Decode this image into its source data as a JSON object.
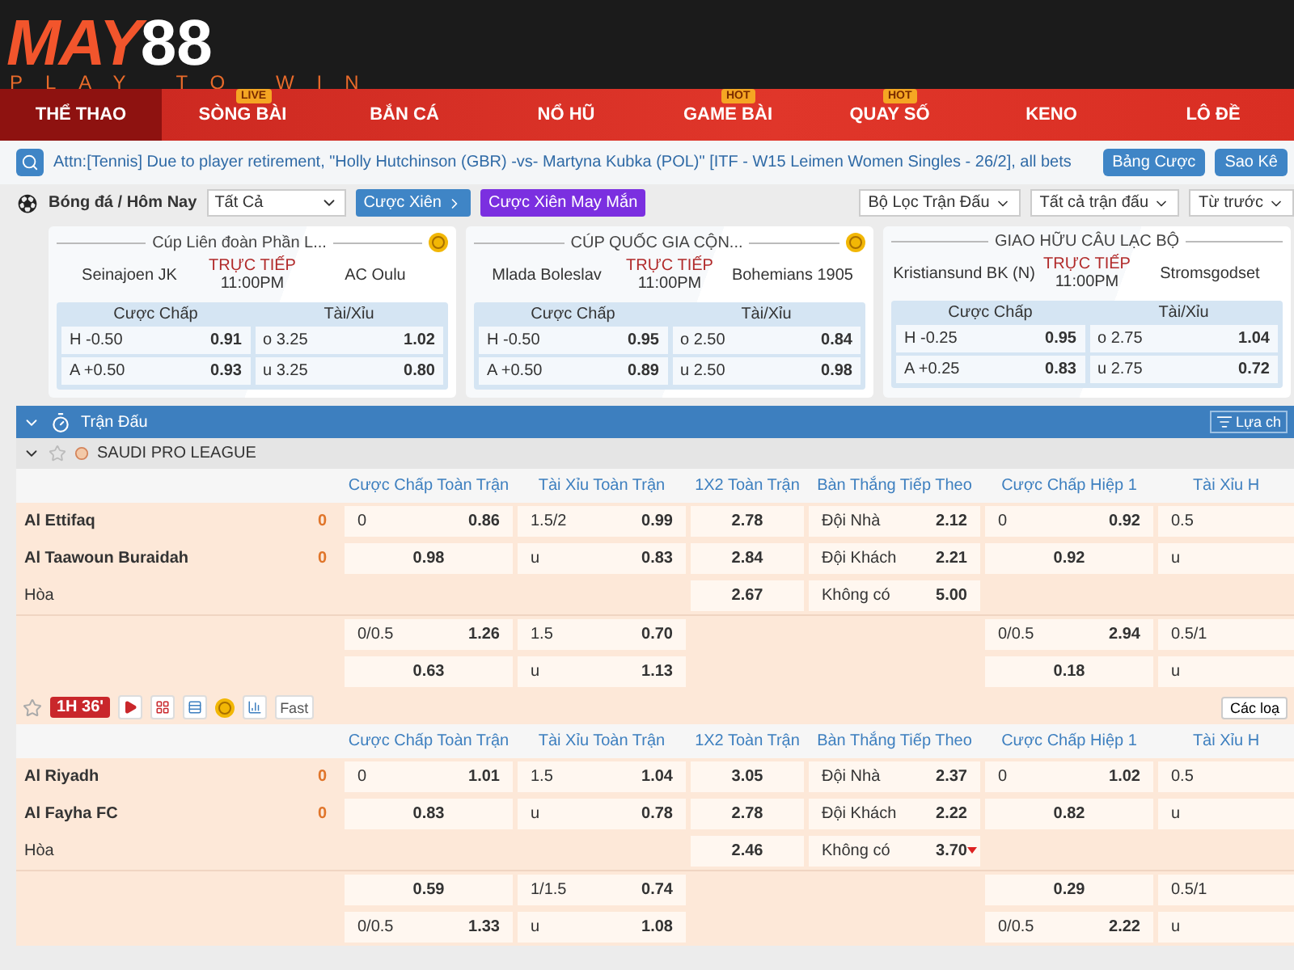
{
  "logo": {
    "brand_a": "MAY",
    "brand_b": "88",
    "tagline": "PLAY TO WIN"
  },
  "nav": [
    {
      "label": "THỂ THAO",
      "selected": true
    },
    {
      "label": "SÒNG BÀI",
      "selected": false,
      "badge": "LIVE"
    },
    {
      "label": "BẮN CÁ",
      "selected": false
    },
    {
      "label": "NỔ HŨ",
      "selected": false
    },
    {
      "label": "GAME BÀI",
      "selected": false,
      "badge": "HOT"
    },
    {
      "label": "QUAY SỐ",
      "selected": false,
      "badge": "HOT"
    },
    {
      "label": "KENO",
      "selected": false
    },
    {
      "label": "LÔ ĐỀ",
      "selected": false
    }
  ],
  "notice": {
    "text": "Attn:[Tennis] Due to player retirement, \"Holly Hutchinson (GBR) -vs- Martyna Kubka (POL)\" [ITF - W15 Leimen Women Singles - 26/2], all bets",
    "buttons": [
      "Bảng Cược",
      "Sao Kê"
    ]
  },
  "filter_bar": {
    "title": "Bóng đá / Hôm Nay",
    "select": "Tất Cả",
    "parlay": "Cược Xiên",
    "lucky_parlay": "Cược Xiên May Mắn",
    "dropdowns": [
      "Bộ Lọc Trận Đấu",
      "Tất cả trận đấu",
      "Từ trước"
    ]
  },
  "cards": [
    {
      "league": "Cúp Liên đoàn Phần L...",
      "coin": true,
      "home": "Seinajoen JK",
      "away": "AC Oulu",
      "status": "TRỰC TIẾP",
      "time": "11:00PM",
      "handicap_title": "Cược Chấp",
      "ou_title": "Tài/Xỉu",
      "handicap": [
        {
          "side": "H",
          "line": "-0.50",
          "odds": "0.91"
        },
        {
          "side": "A",
          "line": "+0.50",
          "odds": "0.93"
        }
      ],
      "ou": [
        {
          "side": "o",
          "line": "3.25",
          "odds": "1.02"
        },
        {
          "side": "u",
          "line": "3.25",
          "odds": "0.80"
        }
      ]
    },
    {
      "league": "CÚP QUỐC GIA CỘN...",
      "coin": true,
      "home": "Mlada Boleslav",
      "away": "Bohemians 1905",
      "status": "TRỰC TIẾP",
      "time": "11:00PM",
      "handicap_title": "Cược Chấp",
      "ou_title": "Tài/Xỉu",
      "handicap": [
        {
          "side": "H",
          "line": "-0.50",
          "odds": "0.95"
        },
        {
          "side": "A",
          "line": "+0.50",
          "odds": "0.89"
        }
      ],
      "ou": [
        {
          "side": "o",
          "line": "2.50",
          "odds": "0.84"
        },
        {
          "side": "u",
          "line": "2.50",
          "odds": "0.98"
        }
      ]
    },
    {
      "league": "GIAO HỮU CÂU LẠC BỘ",
      "coin": false,
      "home": "Kristiansund BK (N)",
      "away": "Stromsgodset",
      "status": "TRỰC TIẾP",
      "time": "11:00PM",
      "handicap_title": "Cược Chấp",
      "ou_title": "Tài/Xỉu",
      "handicap": [
        {
          "side": "H",
          "line": "-0.25",
          "odds": "0.95"
        },
        {
          "side": "A",
          "line": "+0.25",
          "odds": "0.83"
        }
      ],
      "ou": [
        {
          "side": "o",
          "line": "2.75",
          "odds": "1.04"
        },
        {
          "side": "u",
          "line": "2.75",
          "odds": "0.72"
        }
      ]
    }
  ],
  "section": {
    "title": "Trận Đấu",
    "button": "Lựa ch"
  },
  "league": {
    "name": "SAUDI PRO LEAGUE"
  },
  "matches": [
    {
      "columns": [
        "Cược Chấp Toàn Trận",
        "Tài Xỉu Toàn Trận",
        "1X2 Toàn Trận",
        "Bàn Thắng Tiếp Theo",
        "Cược Chấp Hiệp 1",
        "Tài Xỉu H"
      ],
      "rows": [
        {
          "team": "Al Ettifaq",
          "score": "0",
          "cells": [
            {
              "line": "0",
              "odds": "0.86"
            },
            {
              "line": "1.5/2",
              "odds": "0.99"
            },
            {
              "odds": "2.78"
            },
            {
              "line": "Đội Nhà",
              "odds": "2.12"
            },
            {
              "line": "0",
              "odds": "0.92"
            },
            {
              "line": "0.5"
            }
          ]
        },
        {
          "team": "Al Taawoun Buraidah",
          "score": "0",
          "cells": [
            {
              "odds": "0.98"
            },
            {
              "line": "u",
              "odds": "0.83"
            },
            {
              "odds": "2.84"
            },
            {
              "line": "Đội Khách",
              "odds": "2.21"
            },
            {
              "odds": "0.92"
            },
            {
              "line": "u"
            }
          ]
        },
        {
          "draw": "Hòa",
          "cells": [
            null,
            null,
            {
              "odds": "2.67"
            },
            {
              "line": "Không có",
              "odds": "5.00"
            },
            null,
            null
          ]
        }
      ],
      "extra_rows": [
        {
          "cells": [
            {
              "line": "0/0.5",
              "odds": "1.26"
            },
            {
              "line": "1.5",
              "odds": "0.70"
            },
            null,
            null,
            {
              "line": "0/0.5",
              "odds": "2.94"
            },
            {
              "line": "0.5/1"
            }
          ]
        },
        {
          "cells": [
            {
              "odds": "0.63"
            },
            {
              "line": "u",
              "odds": "1.13"
            },
            null,
            null,
            {
              "odds": "0.18"
            },
            {
              "line": "u"
            }
          ]
        }
      ]
    },
    {
      "toolbar": {
        "clock": "1H 36'",
        "fast": "Fast",
        "more": "Các loạ"
      },
      "columns": [
        "Cược Chấp Toàn Trận",
        "Tài Xỉu Toàn Trận",
        "1X2 Toàn Trận",
        "Bàn Thắng Tiếp Theo",
        "Cược Chấp Hiệp 1",
        "Tài Xỉu H"
      ],
      "rows": [
        {
          "team": "Al Riyadh",
          "score": "0",
          "cells": [
            {
              "line": "0",
              "odds": "1.01"
            },
            {
              "line": "1.5",
              "odds": "1.04"
            },
            {
              "odds": "3.05"
            },
            {
              "line": "Đội Nhà",
              "odds": "2.37"
            },
            {
              "line": "0",
              "odds": "1.02"
            },
            {
              "line": "0.5"
            }
          ]
        },
        {
          "team": "Al Fayha FC",
          "score": "0",
          "cells": [
            {
              "odds": "0.83"
            },
            {
              "line": "u",
              "odds": "0.78"
            },
            {
              "odds": "2.78"
            },
            {
              "line": "Đội Khách",
              "odds": "2.22"
            },
            {
              "odds": "0.82"
            },
            {
              "line": "u"
            }
          ]
        },
        {
          "draw": "Hòa",
          "cells": [
            null,
            null,
            {
              "odds": "2.46"
            },
            {
              "line": "Không có",
              "odds": "3.70",
              "falling": true
            },
            null,
            null
          ]
        }
      ],
      "extra_rows": [
        {
          "cells": [
            {
              "odds": "0.59"
            },
            {
              "line": "1/1.5",
              "odds": "0.74"
            },
            null,
            null,
            {
              "odds": "0.29"
            },
            {
              "line": "0.5/1"
            }
          ]
        },
        {
          "cells": [
            {
              "line": "0/0.5",
              "odds": "1.33"
            },
            {
              "line": "u",
              "odds": "1.08"
            },
            null,
            null,
            {
              "line": "0/0.5",
              "odds": "2.22"
            },
            {
              "line": "u"
            }
          ]
        }
      ]
    }
  ]
}
